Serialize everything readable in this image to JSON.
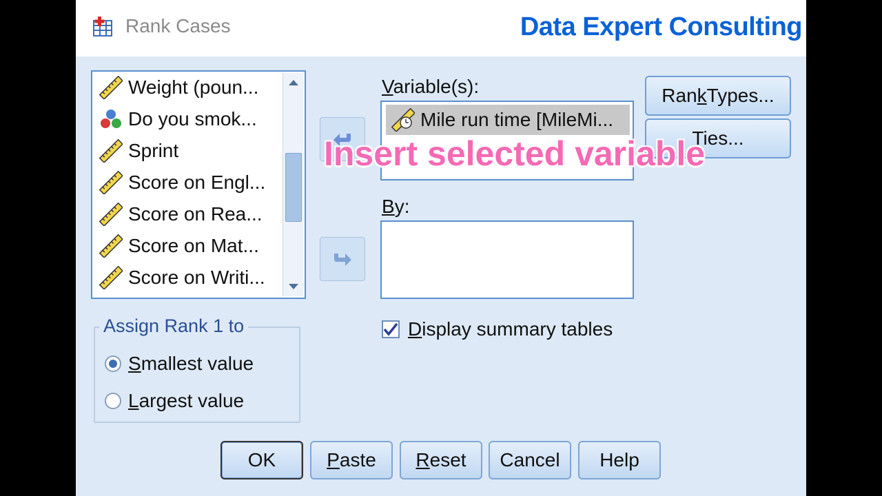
{
  "window": {
    "title": "Rank Cases",
    "brand_overlay": "Data Expert Consulting"
  },
  "source_list": {
    "items": [
      {
        "label": "Weight (poun...",
        "icon": "scale-ruler-icon"
      },
      {
        "label": "Do you smok...",
        "icon": "nominal-balls-icon"
      },
      {
        "label": "Sprint",
        "icon": "scale-ruler-icon"
      },
      {
        "label": "Score on Engl...",
        "icon": "scale-ruler-icon"
      },
      {
        "label": "Score on Rea...",
        "icon": "scale-ruler-icon"
      },
      {
        "label": "Score on Mat...",
        "icon": "scale-ruler-icon"
      },
      {
        "label": "Score on Writi...",
        "icon": "scale-ruler-icon"
      }
    ]
  },
  "variables": {
    "label_pre": "",
    "label_mn": "V",
    "label_post": "ariable(s):",
    "items": [
      {
        "label": "Mile run time [MileMi...",
        "icon": "scale-clock-icon"
      }
    ]
  },
  "by": {
    "label_mn": "B",
    "label_post": "y:"
  },
  "side_buttons": {
    "rank_types_pre": "Ran",
    "rank_types_mn": "k",
    "rank_types_post": " Types...",
    "ties": "Ties..."
  },
  "overlay_caption": "Insert selected variable",
  "display_summary": {
    "checked": true,
    "label_mn": "D",
    "label_post": "isplay summary tables"
  },
  "assign_rank": {
    "legend": "Assign Rank 1 to",
    "options": [
      {
        "mn": "S",
        "post": "mallest value",
        "selected": true
      },
      {
        "mn": "L",
        "post": "argest value",
        "selected": false
      }
    ]
  },
  "bottom_buttons": {
    "ok": "OK",
    "paste_mn": "P",
    "paste_post": "aste",
    "reset_mn": "R",
    "reset_post": "eset",
    "cancel": "Cancel",
    "help": "Help"
  },
  "colors": {
    "dialog_bg": "#dde9f6",
    "brand": "#0b62d6",
    "overlay": "#f56ab4"
  }
}
